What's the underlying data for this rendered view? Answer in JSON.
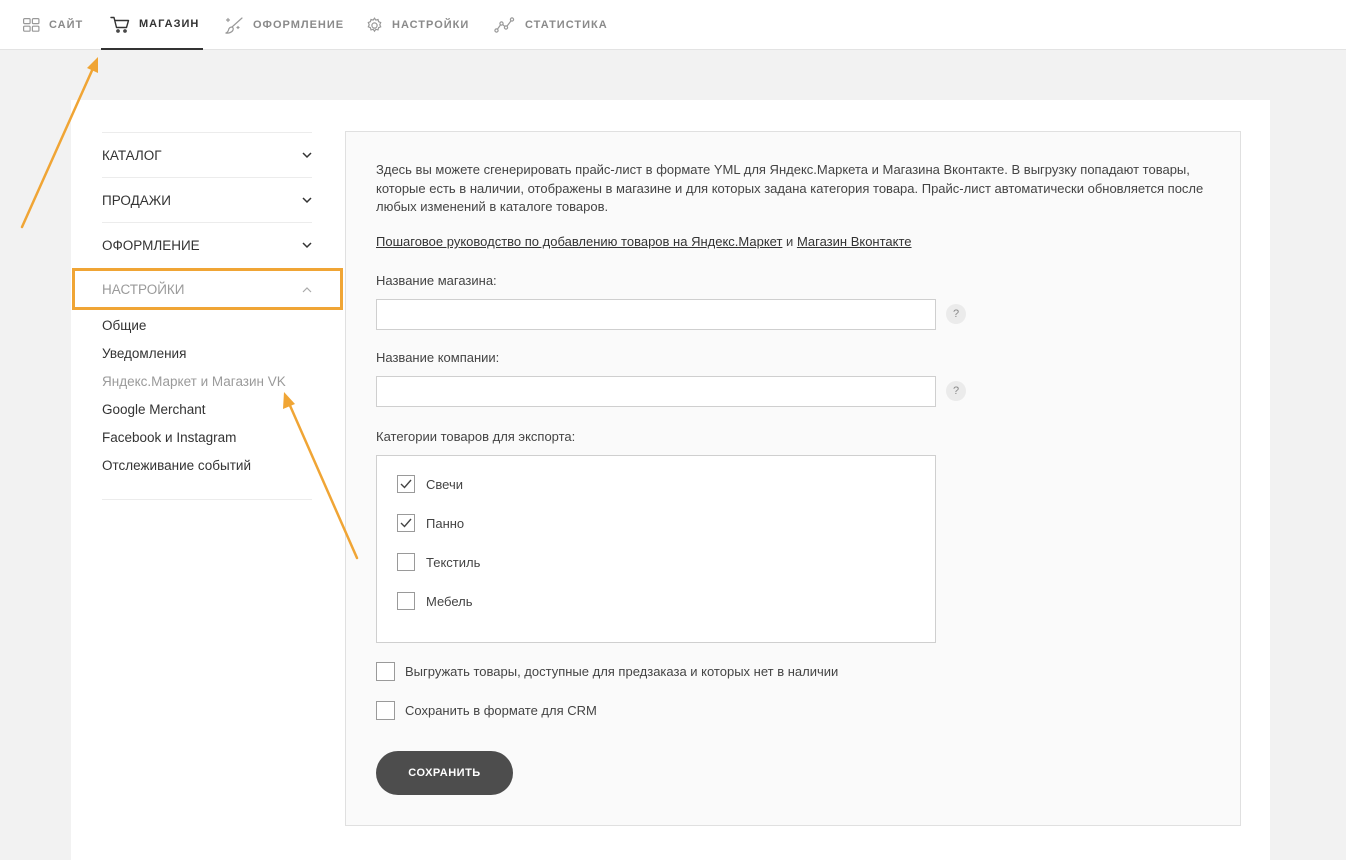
{
  "topnav": {
    "tabs": [
      {
        "label": "САЙТ",
        "icon": "grid-icon"
      },
      {
        "label": "МАГАЗИН",
        "icon": "cart-icon",
        "active": true
      },
      {
        "label": "ОФОРМЛЕНИЕ",
        "icon": "brush-icon"
      },
      {
        "label": "НАСТРОЙКИ",
        "icon": "gear-icon"
      },
      {
        "label": "СТАТИСТИКА",
        "icon": "chart-line-icon"
      }
    ]
  },
  "sidebar": {
    "sections": [
      {
        "label": "КАТАЛОГ",
        "icon": "chevron-down-icon"
      },
      {
        "label": "ПРОДАЖИ",
        "icon": "chevron-down-icon"
      },
      {
        "label": "ОФОРМЛЕНИЕ",
        "icon": "chevron-down-icon"
      },
      {
        "label": "НАСТРОЙКИ",
        "icon": "chevron-up-icon",
        "expanded": true
      }
    ],
    "settings_links": [
      "Общие",
      "Уведомления",
      "Яндекс.Маркет и Магазин VK",
      "Google Merchant",
      "Facebook и Instagram",
      "Отслеживание событий"
    ],
    "current_link": "Яндекс.Маркет и Магазин VK"
  },
  "main": {
    "intro": "Здесь вы можете сгенерировать прайс-лист в формате YML для Яндекс.Маркета и Магазина Вконтакте. В выгрузку попадают товары, которые есть в наличии, отображены в магазине и для которых задана категория товара. Прайс-лист автоматически обновляется после любых изменений в каталоге товаров.",
    "guide_link": "Пошаговое руководство по добавлению товаров на Яндекс.Маркет",
    "guide_and": "и",
    "vk_link": "Магазин Вконтакте",
    "shop_name_label": "Название магазина:",
    "shop_name_value": "",
    "company_name_label": "Название компании:",
    "company_name_value": "",
    "help_glyph": "?",
    "categories_label": "Категории товаров для экспорта:",
    "categories": [
      {
        "label": "Свечи",
        "checked": true
      },
      {
        "label": "Панно",
        "checked": true
      },
      {
        "label": "Текстиль",
        "checked": false
      },
      {
        "label": "Мебель",
        "checked": false
      }
    ],
    "options": [
      {
        "label": "Выгружать товары, доступные для предзаказа и которых нет в наличии",
        "checked": false
      },
      {
        "label": "Сохранить в формате для CRM",
        "checked": false
      }
    ],
    "save_label": "СОХРАНИТЬ"
  },
  "colors": {
    "accent": "#f0a535",
    "button": "#4d4d4d"
  }
}
